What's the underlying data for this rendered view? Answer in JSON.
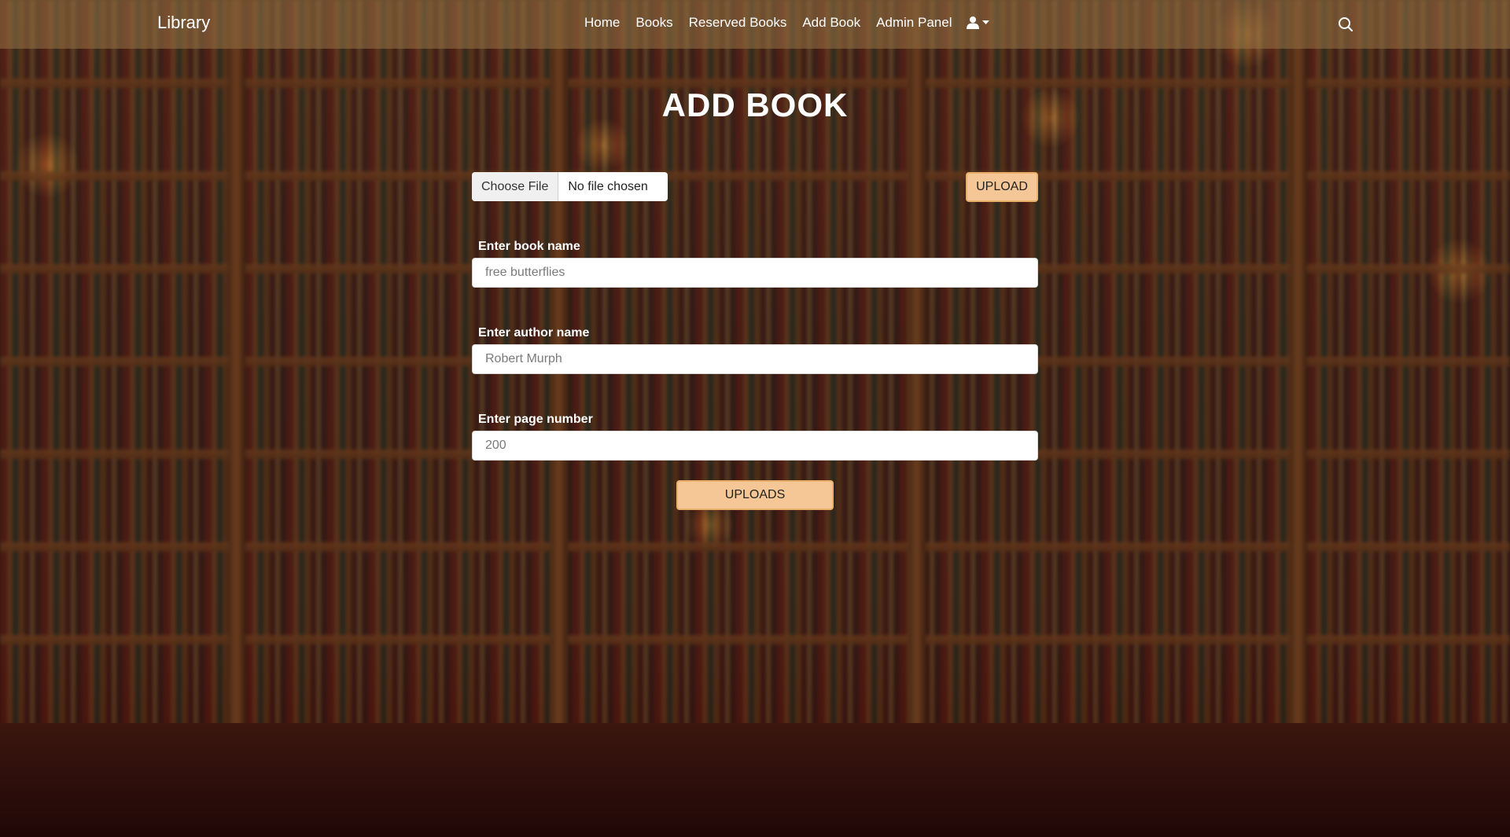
{
  "navbar": {
    "brand": "Library",
    "links": [
      "Home",
      "Books",
      "Reserved Books",
      "Add Book",
      "Admin Panel"
    ],
    "user_icon": "user-icon",
    "dropdown_icon": "caret-down-icon",
    "search_icon": "search-icon"
  },
  "page": {
    "title": "ADD BOOK"
  },
  "file_upload": {
    "choose_label": "Choose File",
    "status": "No file chosen",
    "upload_button": "UPLOAD"
  },
  "form": {
    "book_name": {
      "label": "Enter book name",
      "placeholder": "free butterflies"
    },
    "author_name": {
      "label": "Enter author name",
      "placeholder": "Robert Murph"
    },
    "page_number": {
      "label": "Enter page number",
      "placeholder": "200"
    },
    "submit_button": "UPLOADS"
  },
  "colors": {
    "accent": "#f5c796",
    "accent_border": "#eab06a",
    "navbar_bg": "#96734688"
  }
}
